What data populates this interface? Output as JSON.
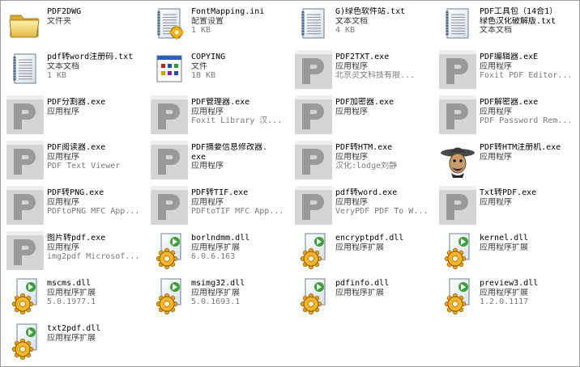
{
  "items": [
    {
      "name": "PDF2DWG",
      "type": "文件夹",
      "detail": "",
      "icon": "folder-icon"
    },
    {
      "name": "FontMapping.ini",
      "type": "配置设置",
      "detail": "1 KB",
      "icon": "ini-config-icon"
    },
    {
      "name": "G)绿色软件站.txt",
      "type": "文本文档",
      "detail": "4 KB",
      "icon": "text-document-icon"
    },
    {
      "name": "PDF工具包（14合1）",
      "name2": "绿色汉化破解版.txt",
      "type": "文本文档",
      "detail": "",
      "icon": "text-document-icon"
    },
    {
      "name": "pdf转word注册码.txt",
      "type": "文本文档",
      "detail": "1 KB",
      "icon": "text-document-icon"
    },
    {
      "name": "COPYING",
      "type": "文件",
      "detail": "18 KB",
      "icon": "generic-file-icon"
    },
    {
      "name": "PDF2TXT.exe",
      "type": "应用程序",
      "detail": "北京灵文科技有限...",
      "icon": "pdf-app-icon"
    },
    {
      "name": "PDF编辑器.exE",
      "type": "应用程序",
      "detail": "Foxit PDF Editor...",
      "icon": "pdf-app-icon"
    },
    {
      "name": "PDF分割器.exe",
      "type": "应用程序",
      "detail": "",
      "icon": "pdf-app-icon"
    },
    {
      "name": "PDF管理器.exe",
      "type": "应用程序",
      "detail": "Foxit Library 汉...",
      "icon": "pdf-app-icon"
    },
    {
      "name": "PDF加密器.exe",
      "type": "应用程序",
      "detail": "",
      "icon": "pdf-app-icon"
    },
    {
      "name": "PDF解密器.exe",
      "type": "应用程序",
      "detail": "PDF Password Rem...",
      "icon": "pdf-app-icon"
    },
    {
      "name": "PDF阅读器.exe",
      "type": "应用程序",
      "detail": "PDF Text Viewer",
      "icon": "pdf-app-icon"
    },
    {
      "name": "PDF摘要信息修改器.",
      "name2": "exe",
      "type": "应用程序",
      "detail": "",
      "icon": "pdf-app-icon"
    },
    {
      "name": "PDF转HTM.exe",
      "type": "应用程序",
      "detail": "汉化:lodge刘静",
      "icon": "pdf-app-icon"
    },
    {
      "name": "PDF转HTM注册机.exe",
      "type": "应用程序",
      "detail": "",
      "icon": "cowboy-icon"
    },
    {
      "name": "PDF转PNG.exe",
      "type": "应用程序",
      "detail": "PDFtoPNG MFC App...",
      "icon": "pdf-app-icon"
    },
    {
      "name": "PDF转TIF.exe",
      "type": "应用程序",
      "detail": "PDFtoTIF MFC App...",
      "icon": "pdf-app-icon"
    },
    {
      "name": "pdf转word.exe",
      "type": "应用程序",
      "detail": "VeryPDF PDF To W...",
      "icon": "pdf-app-icon"
    },
    {
      "name": "Txt转PDF.exe",
      "type": "应用程序",
      "detail": "",
      "icon": "pdf-app-icon"
    },
    {
      "name": "图片转pdf.exe",
      "type": "应用程序",
      "detail": "img2pdf Microsof...",
      "icon": "pdf-app-icon"
    },
    {
      "name": "borlndmm.dll",
      "type": "应用程序扩展",
      "detail": "6.0.6.163",
      "icon": "dll-gear-icon"
    },
    {
      "name": "encryptpdf.dll",
      "type": "应用程序扩展",
      "detail": "",
      "icon": "dll-gear-icon"
    },
    {
      "name": "kernel.dll",
      "type": "应用程序扩展",
      "detail": "",
      "icon": "dll-gear-icon"
    },
    {
      "name": "mscms.dll",
      "type": "应用程序扩展",
      "detail": "5.0.1977.1",
      "icon": "dll-gear-icon"
    },
    {
      "name": "msimg32.dll",
      "type": "应用程序扩展",
      "detail": "5.0.1693.1",
      "icon": "dll-gear-icon"
    },
    {
      "name": "pdfinfo.dll",
      "type": "应用程序扩展",
      "detail": "",
      "icon": "dll-gear-icon"
    },
    {
      "name": "preview3.dll",
      "type": "应用程序扩展",
      "detail": "1.2.0.1117",
      "icon": "dll-gear-icon"
    },
    {
      "name": "txt2pdf.dll",
      "type": "应用程序扩展",
      "detail": "",
      "icon": "dll-gear-icon"
    }
  ]
}
